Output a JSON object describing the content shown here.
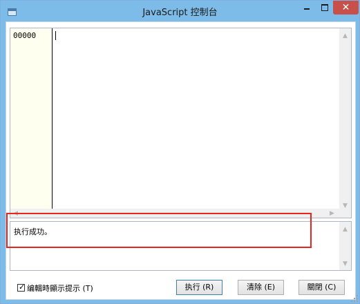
{
  "window": {
    "title": "JavaScript 控制台",
    "close_glyph": "✕"
  },
  "editor": {
    "line_number": "00000"
  },
  "output": {
    "text": "执行成功。"
  },
  "footer": {
    "checkbox_label": "编輯時顯示提示 (T)",
    "checkbox_checked": true,
    "buttons": {
      "run": "执行 (R)",
      "clear": "清除 (E)",
      "close": "關閉 (C)"
    }
  },
  "colors": {
    "titlebar": "#7dbce8",
    "close_button": "#c7504a",
    "gutter": "#fffff0",
    "highlight": "#e8241c"
  }
}
